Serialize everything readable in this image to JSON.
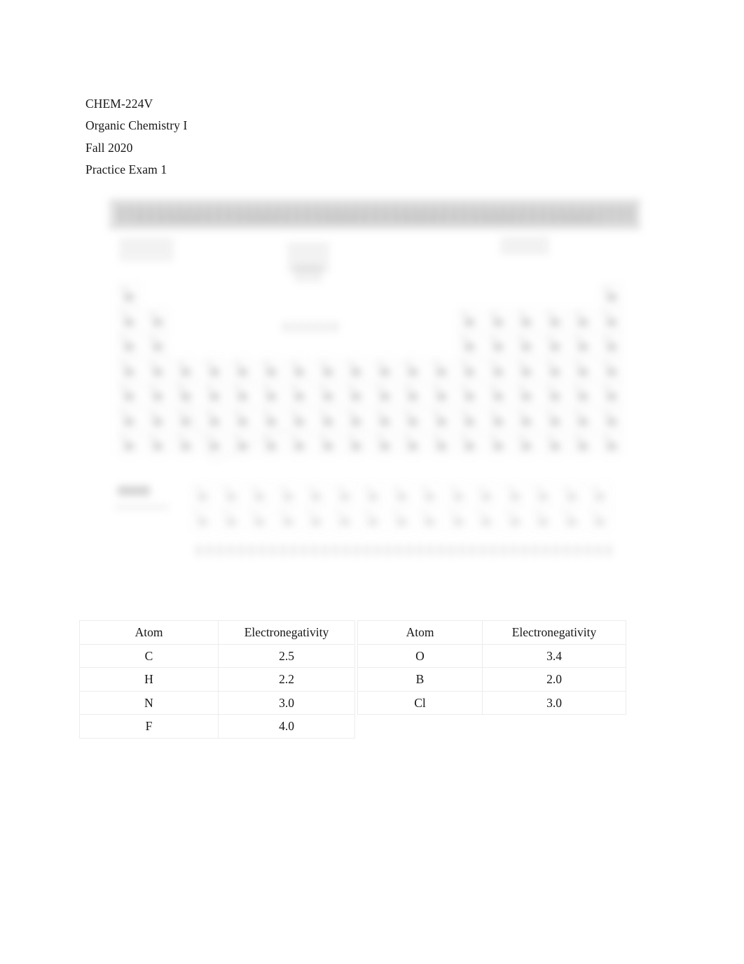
{
  "document": {
    "header_lines": [
      "CHEM-224V",
      "Organic Chemistry I",
      "Fall 2020",
      "Practice Exam 1"
    ]
  },
  "figure": {
    "name": "periodic-table-image",
    "description": "Heavily blurred scanned periodic table of the elements with a dark gray title banner across the top, a grid of element cells, a stair-step metalloid line, lanthanide and actinide rows at the bottom, and an illegible caption line beneath the grid.",
    "legible": "false",
    "titlebar_color": "#cfcfcf"
  },
  "tables": {
    "left": {
      "headers": [
        "Atom",
        "Electronegativity"
      ],
      "rows": [
        [
          "C",
          "2.5"
        ],
        [
          "H",
          "2.2"
        ],
        [
          "N",
          "3.0"
        ],
        [
          "F",
          "4.0"
        ]
      ]
    },
    "right": {
      "headers": [
        "Atom",
        "Electronegativity"
      ],
      "rows": [
        [
          "O",
          "3.4"
        ],
        [
          "B",
          "2.0"
        ],
        [
          "Cl",
          "3.0"
        ]
      ]
    },
    "border_color": "#ececec"
  }
}
